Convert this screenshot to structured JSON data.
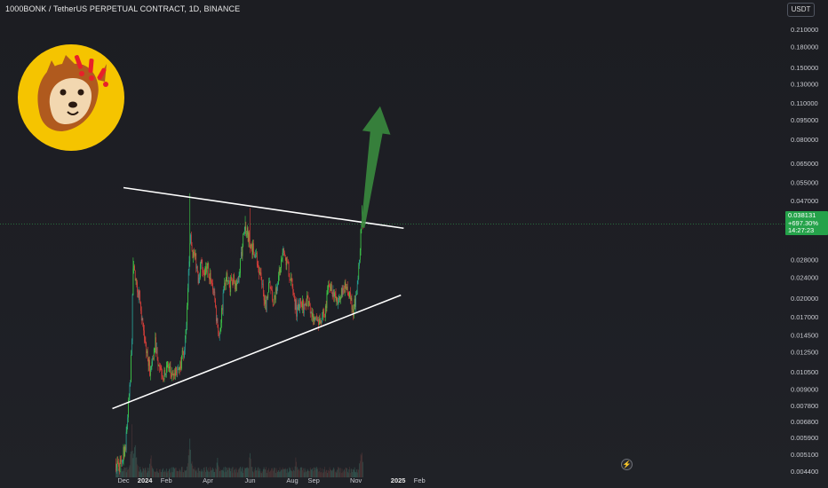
{
  "header": {
    "title": "1000BONK / TetherUS PERPETUAL CONTRACT, 1D, BINANCE",
    "currency": "USDT"
  },
  "price_tag": {
    "price": "0.038131",
    "change": "+697.30%",
    "countdown": "14:27:23"
  },
  "icons": {
    "logo": "bonk-dog-logo",
    "alert": "lightning-icon"
  },
  "colors": {
    "up": "#26a69a",
    "up_bright": "#3fd24a",
    "down": "#e0403a",
    "arrow": "#3a8a3e",
    "trendline": "#ffffff",
    "tag": "#25a24a",
    "logo_bg": "#f5c400"
  },
  "chart_data": {
    "type": "candlestick",
    "y_scale": "log",
    "ylim": [
      0.0041,
      0.225
    ],
    "y_ticks": [
      "0.210000",
      "0.180000",
      "0.150000",
      "0.130000",
      "0.110000",
      "0.095000",
      "0.080000",
      "0.065000",
      "0.055000",
      "0.047000",
      "0.028000",
      "0.024000",
      "0.020000",
      "0.017000",
      "0.014500",
      "0.012500",
      "0.010500",
      "0.009000",
      "0.007800",
      "0.006800",
      "0.005900",
      "0.005100",
      "0.004400"
    ],
    "x_ticks": [
      "Dec",
      "2024",
      "Feb",
      "Apr",
      "Jun",
      "Aug",
      "Sep",
      "Nov",
      "2025",
      "Feb"
    ],
    "x_tick_dates": [
      "2023-12-01",
      "2024-01-01",
      "2024-02-01",
      "2024-04-01",
      "2024-06-01",
      "2024-08-01",
      "2024-09-01",
      "2024-11-01",
      "2025-01-01",
      "2025-02-01"
    ],
    "last_price": 0.038131,
    "trendlines": [
      {
        "name": "upper",
        "from": [
          "2023-12-01",
          0.0525
        ],
        "to": [
          "2025-01-09",
          0.0368
        ]
      },
      {
        "name": "lower",
        "from": [
          "2023-11-15",
          0.0076
        ],
        "to": [
          "2025-01-05",
          0.0205
        ]
      }
    ],
    "arrow": {
      "from": [
        "2024-11-11",
        0.037
      ],
      "to": [
        "2024-12-06",
        0.107
      ]
    },
    "price_path": [
      [
        "2023-11-20",
        0.0047
      ],
      [
        "2023-11-27",
        0.0046
      ],
      [
        "2023-12-04",
        0.0056
      ],
      [
        "2023-12-08",
        0.0078
      ],
      [
        "2023-12-11",
        0.0095
      ],
      [
        "2023-12-13",
        0.0145
      ],
      [
        "2023-12-15",
        0.026
      ],
      [
        "2023-12-18",
        0.024
      ],
      [
        "2023-12-22",
        0.021
      ],
      [
        "2023-12-26",
        0.0185
      ],
      [
        "2023-12-31",
        0.0135
      ],
      [
        "2024-01-04",
        0.0125
      ],
      [
        "2024-01-08",
        0.0105
      ],
      [
        "2024-01-12",
        0.0115
      ],
      [
        "2024-01-16",
        0.0135
      ],
      [
        "2024-01-20",
        0.0118
      ],
      [
        "2024-01-24",
        0.0108
      ],
      [
        "2024-01-28",
        0.0102
      ],
      [
        "2024-02-01",
        0.0113
      ],
      [
        "2024-02-06",
        0.0105
      ],
      [
        "2024-02-11",
        0.0098
      ],
      [
        "2024-02-16",
        0.0108
      ],
      [
        "2024-02-21",
        0.0112
      ],
      [
        "2024-02-26",
        0.0125
      ],
      [
        "2024-03-01",
        0.0152
      ],
      [
        "2024-03-04",
        0.0245
      ],
      [
        "2024-03-06",
        0.034
      ],
      [
        "2024-03-10",
        0.03
      ],
      [
        "2024-03-14",
        0.028
      ],
      [
        "2024-03-18",
        0.024
      ],
      [
        "2024-03-22",
        0.027
      ],
      [
        "2024-03-27",
        0.025
      ],
      [
        "2024-04-01",
        0.026
      ],
      [
        "2024-04-05",
        0.024
      ],
      [
        "2024-04-10",
        0.021
      ],
      [
        "2024-04-14",
        0.016
      ],
      [
        "2024-04-18",
        0.0148
      ],
      [
        "2024-04-23",
        0.02
      ],
      [
        "2024-04-27",
        0.024
      ],
      [
        "2024-05-02",
        0.022
      ],
      [
        "2024-05-07",
        0.024
      ],
      [
        "2024-05-12",
        0.022
      ],
      [
        "2024-05-17",
        0.026
      ],
      [
        "2024-05-22",
        0.034
      ],
      [
        "2024-05-26",
        0.036
      ],
      [
        "2024-05-30",
        0.034
      ],
      [
        "2024-06-04",
        0.031
      ],
      [
        "2024-06-09",
        0.03
      ],
      [
        "2024-06-14",
        0.025
      ],
      [
        "2024-06-19",
        0.022
      ],
      [
        "2024-06-24",
        0.019
      ],
      [
        "2024-06-29",
        0.023
      ],
      [
        "2024-07-04",
        0.019
      ],
      [
        "2024-07-09",
        0.022
      ],
      [
        "2024-07-14",
        0.026
      ],
      [
        "2024-07-19",
        0.03
      ],
      [
        "2024-07-23",
        0.028
      ],
      [
        "2024-07-28",
        0.025
      ],
      [
        "2024-08-02",
        0.021
      ],
      [
        "2024-08-07",
        0.018
      ],
      [
        "2024-08-12",
        0.019
      ],
      [
        "2024-08-17",
        0.0185
      ],
      [
        "2024-08-22",
        0.02
      ],
      [
        "2024-08-27",
        0.0175
      ],
      [
        "2024-09-01",
        0.0165
      ],
      [
        "2024-09-06",
        0.016
      ],
      [
        "2024-09-11",
        0.0168
      ],
      [
        "2024-09-16",
        0.0173
      ],
      [
        "2024-09-21",
        0.021
      ],
      [
        "2024-09-26",
        0.0225
      ],
      [
        "2024-09-30",
        0.0205
      ],
      [
        "2024-10-05",
        0.019
      ],
      [
        "2024-10-10",
        0.0205
      ],
      [
        "2024-10-15",
        0.022
      ],
      [
        "2024-10-19",
        0.0215
      ],
      [
        "2024-10-24",
        0.0195
      ],
      [
        "2024-10-28",
        0.018
      ],
      [
        "2024-11-02",
        0.02
      ],
      [
        "2024-11-06",
        0.0275
      ],
      [
        "2024-11-08",
        0.035
      ],
      [
        "2024-11-10",
        0.04
      ],
      [
        "2024-11-11",
        0.0381
      ]
    ],
    "spikes": [
      [
        "2024-03-06",
        0.05
      ],
      [
        "2024-06-01",
        0.044
      ],
      [
        "2024-11-10",
        0.045
      ],
      [
        "2023-12-15",
        0.0285
      ],
      [
        "2024-05-25",
        0.041
      ]
    ],
    "volume_spikes": [
      [
        "2023-12-13",
        1.0
      ],
      [
        "2023-12-18",
        0.9
      ],
      [
        "2024-01-10",
        0.5
      ],
      [
        "2024-03-06",
        0.85
      ],
      [
        "2024-04-15",
        0.45
      ],
      [
        "2024-06-01",
        0.55
      ],
      [
        "2024-08-06",
        0.45
      ],
      [
        "2024-11-09",
        0.75
      ]
    ]
  }
}
